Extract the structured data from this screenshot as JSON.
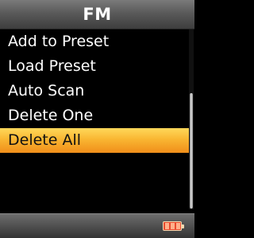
{
  "header": {
    "title": "FM"
  },
  "menu": {
    "items": [
      {
        "label": "Add to Preset"
      },
      {
        "label": "Load Preset"
      },
      {
        "label": "Auto Scan"
      },
      {
        "label": "Delete One"
      },
      {
        "label": "Delete All"
      }
    ],
    "selected_index": 4
  },
  "scrollbar": {
    "visible_fraction": 0.64
  },
  "status": {
    "battery_icon": "battery-icon",
    "battery_color": "#e84a2e"
  },
  "colors": {
    "highlight": "#f9b632",
    "background": "#000000",
    "text": "#ffffff"
  }
}
